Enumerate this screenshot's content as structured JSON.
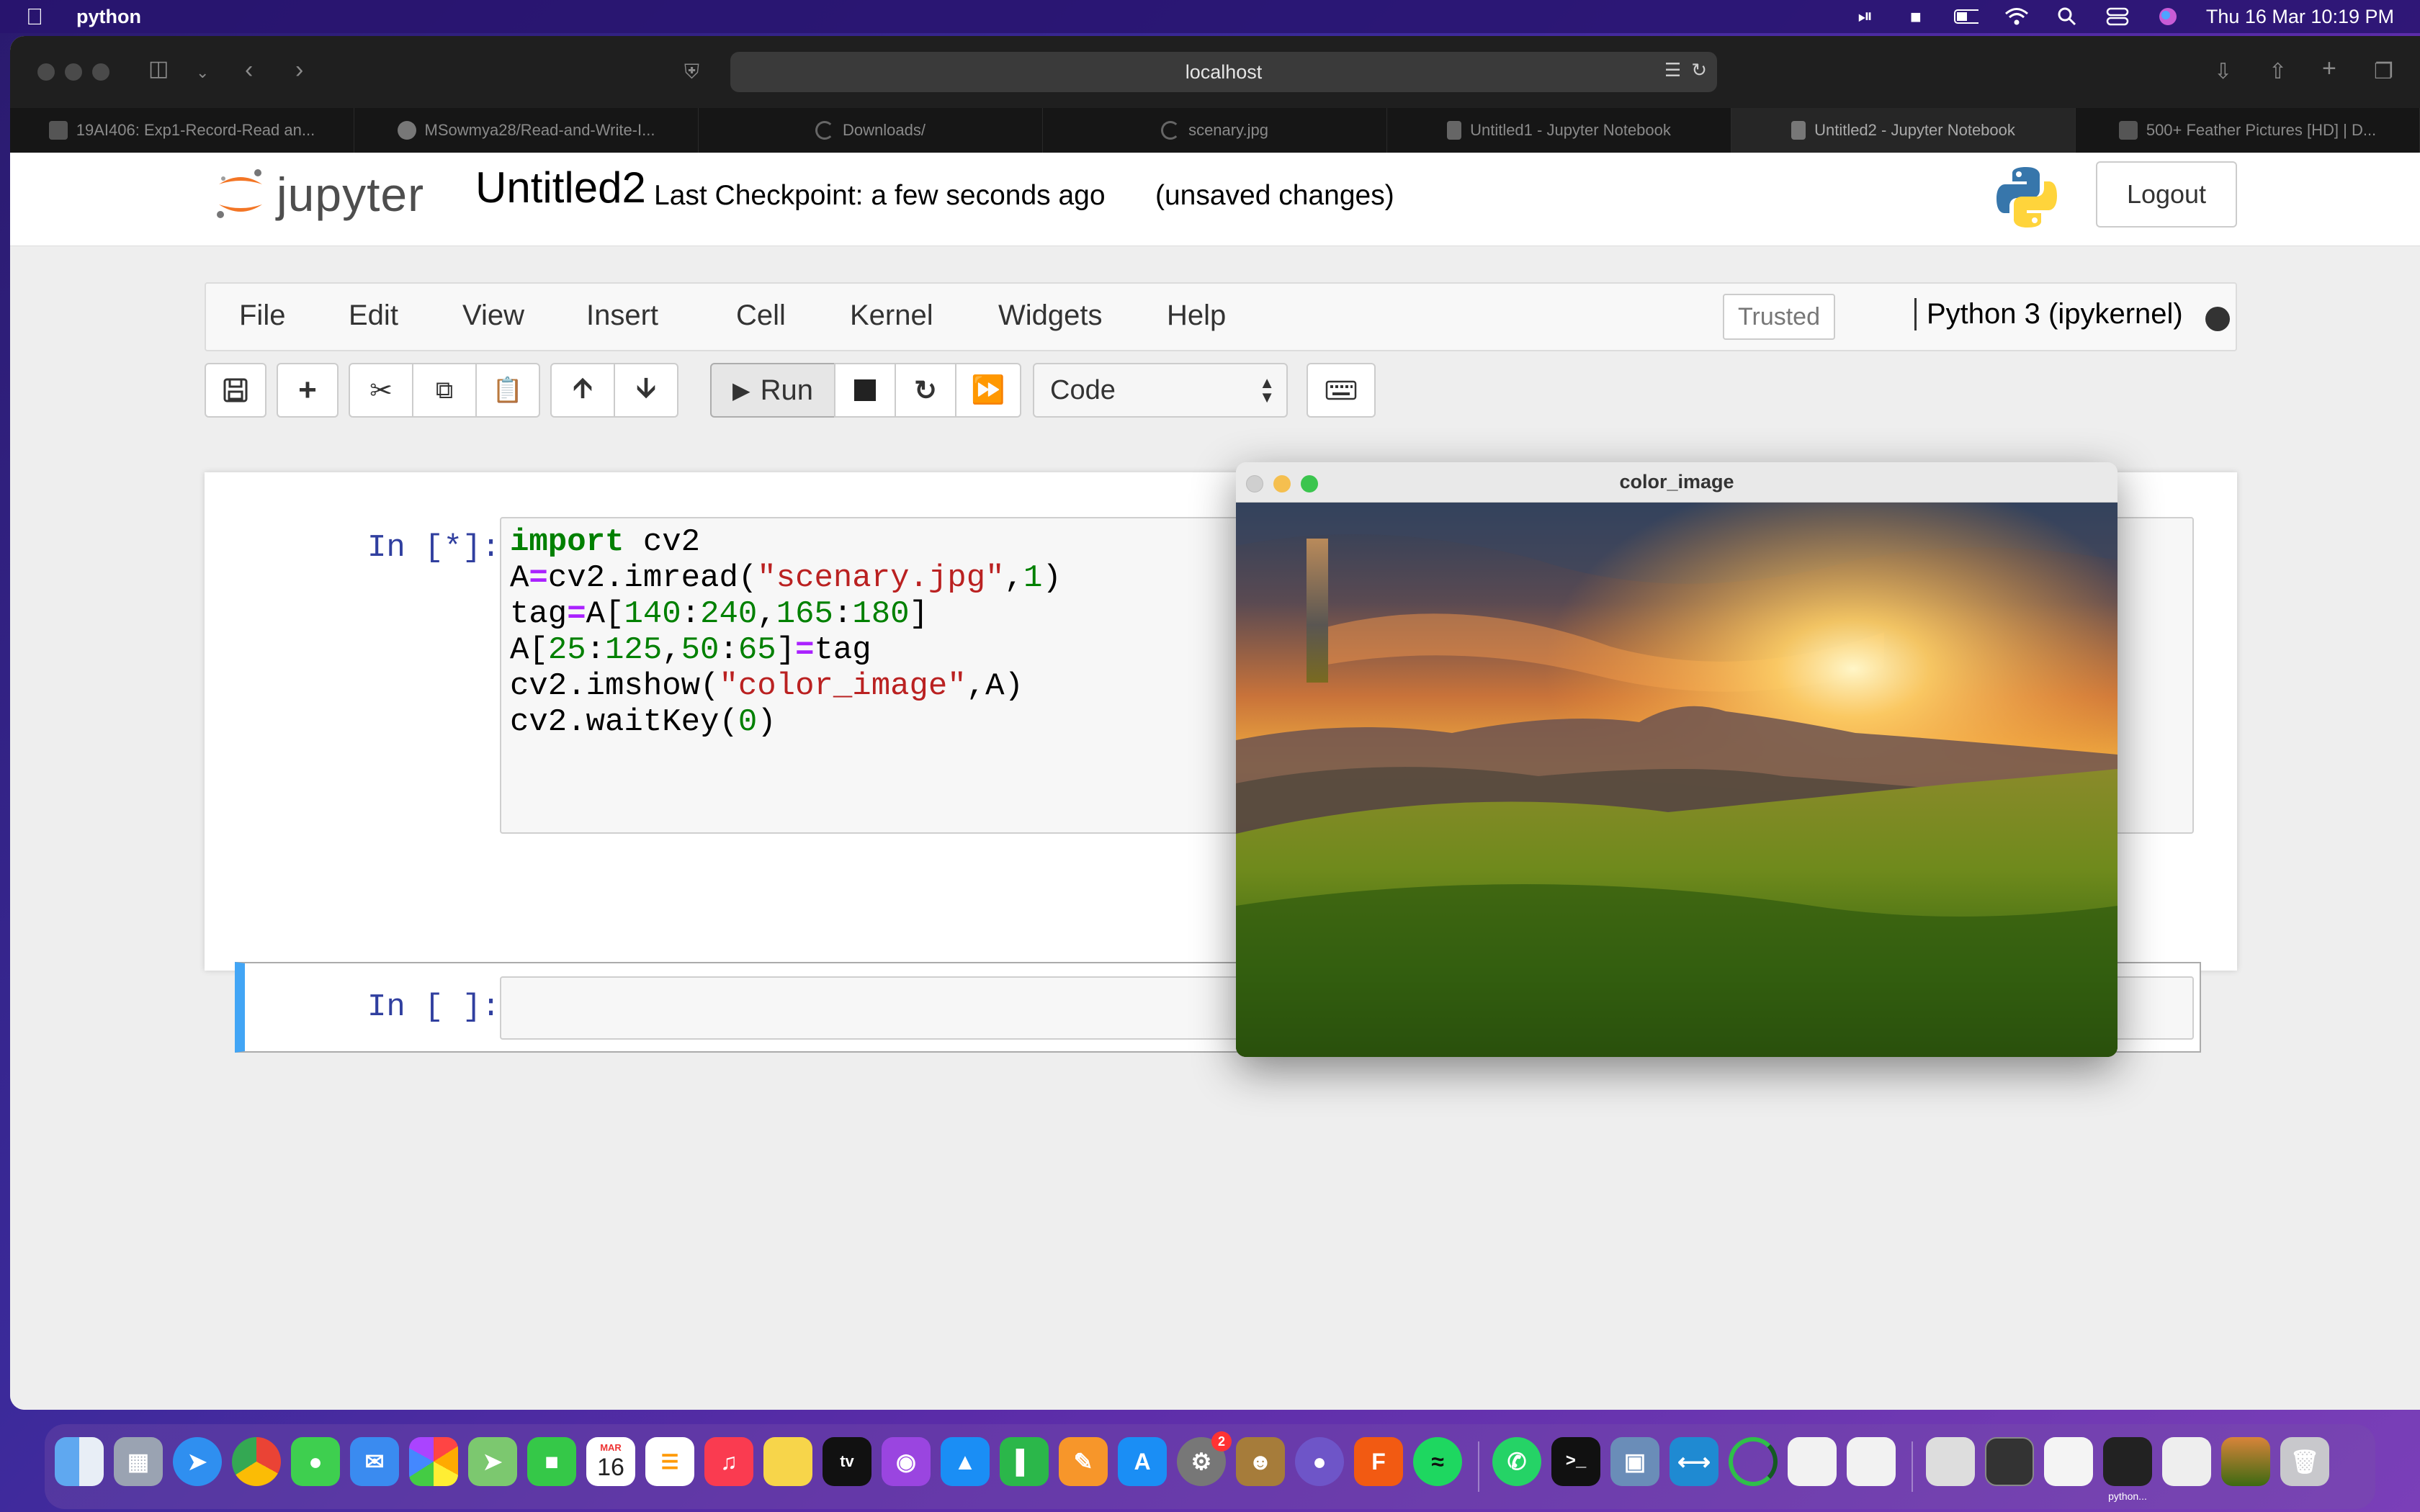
{
  "menubar": {
    "app_name": "python",
    "datetime": "Thu 16 Mar  10:19 PM",
    "status_icons": [
      "screen-record-icon",
      "car-icon",
      "battery-icon",
      "wifi-icon",
      "spotlight-icon",
      "control-center-icon",
      "siri-icon"
    ]
  },
  "browser": {
    "address": "localhost",
    "tabs": [
      {
        "label": "19AI406: Exp1-Record-Read an...",
        "icon": "site-icon"
      },
      {
        "label": "MSowmya28/Read-and-Write-I...",
        "icon": "github-icon"
      },
      {
        "label": "Downloads/",
        "icon": "loading-icon"
      },
      {
        "label": "scenary.jpg",
        "icon": "loading-icon"
      },
      {
        "label": "Untitled1 - Jupyter Notebook",
        "icon": "notebook-icon"
      },
      {
        "label": "Untitled2 - Jupyter Notebook",
        "icon": "notebook-icon"
      },
      {
        "label": "500+ Feather Pictures [HD] | D...",
        "icon": "site-icon"
      }
    ],
    "active_tab": 5
  },
  "jupyter": {
    "logo_text": "jupyter",
    "notebook_name": "Untitled2",
    "checkpoint": "Last Checkpoint: a few seconds ago",
    "unsaved": "(unsaved changes)",
    "logout": "Logout",
    "menu": [
      "File",
      "Edit",
      "View",
      "Insert",
      "Cell",
      "Kernel",
      "Widgets",
      "Help"
    ],
    "trusted": "Trusted",
    "kernel": "Python 3 (ipykernel)",
    "toolbar": {
      "run_label": "Run",
      "cell_type": "Code"
    },
    "cells": [
      {
        "prompt": "In [*]:",
        "code": [
          "import cv2",
          "A=cv2.imread(\"scenary.jpg\",1)",
          "tag=A[140:240,165:180]",
          "A[25:125,50:65]=tag",
          "cv2.imshow(\"color_image\",A)",
          "cv2.waitKey(0)"
        ]
      },
      {
        "prompt": "In [ ]:",
        "code": []
      }
    ]
  },
  "cv_window": {
    "title": "color_image"
  },
  "dock": {
    "calendar_month": "MAR",
    "calendar_day": "16",
    "badge_settings": "2",
    "minimized_label": "python..."
  }
}
